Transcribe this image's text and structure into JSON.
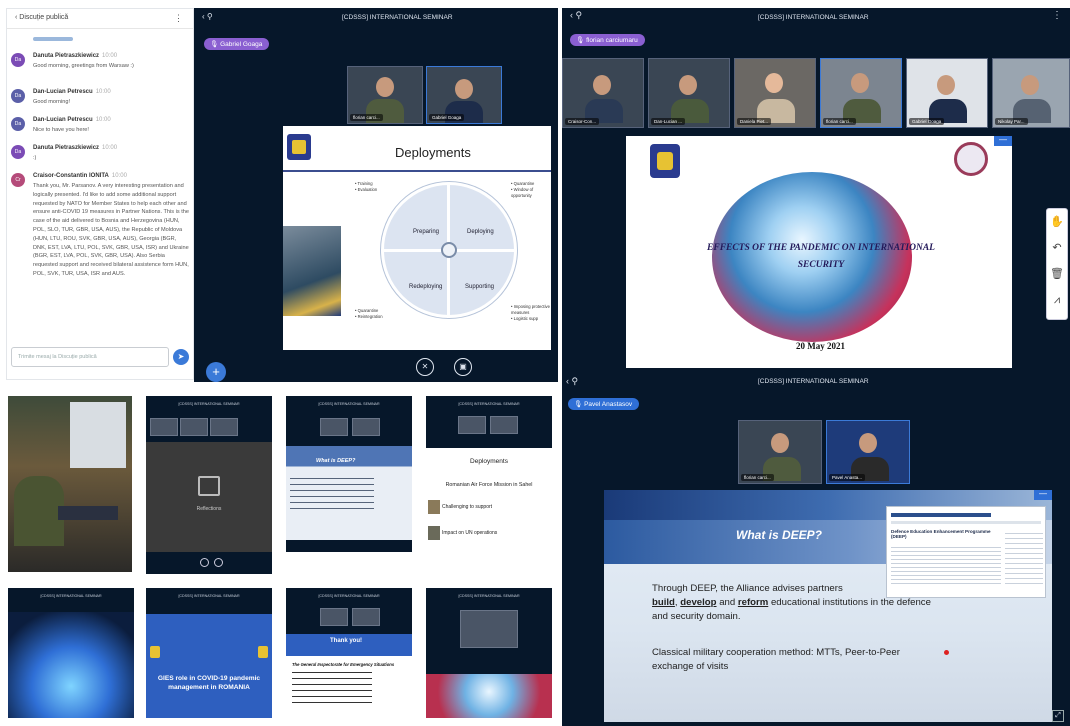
{
  "chat": {
    "title": "Discuție publică",
    "messages": [
      {
        "name": "Danuta Pietraszkiewicz",
        "time": "10:00",
        "text": "Good morning, greetings from Warsaw :)",
        "initials": "Da",
        "color": "#7b4bb5"
      },
      {
        "name": "Dan-Lucian Petrescu",
        "time": "10:00",
        "text": "Good morning!",
        "initials": "Da",
        "color": "#5b5fa8"
      },
      {
        "name": "Dan-Lucian Petrescu",
        "time": "10:00",
        "text": "Nice to have you here!",
        "initials": "Da",
        "color": "#5b5fa8"
      },
      {
        "name": "Danuta Pietraszkiewicz",
        "time": "10:00",
        "text": ":)",
        "initials": "Da",
        "color": "#7b4bb5"
      },
      {
        "name": "Craisor-Constantin IONITA",
        "time": "10:00",
        "text": "Thank you, Mr. Parsanov. A very interesting presentation and logically presented. I'd like to add some additional support requested by NATO for Member States to help each other and ensure anti-COVID 19 measures in Partner Nations. This is the case of the aid delivered to Bosnia and Herzegovina (HUN, POL, SLO, TUR, GBR, USA, AUS), the Republic of Moldova (HUN, LTU, ROU, SVK, GBR, USA, AUS), Georgia (BGR, DNK, EST, LVA, LTU, POL, SVK, GBR, USA, ISR) and Ukraine (BGR, EST, LVA, POL, SVK, GBR, USA). Also Serbia requested support and received bilateral assistence form HUN, POL, SVK, TUR, USA, ISR and AUS.",
        "initials": "Cr",
        "color": "#b54b7a"
      }
    ],
    "input_placeholder": "Trimite mesaj la Discuție publică"
  },
  "meeting1": {
    "title": "[CDSSS] INTERNATIONAL SEMINAR",
    "presenter": "Gabriel Goaga",
    "participants": [
      "florian carci...",
      "Gabriel Goaga"
    ],
    "slide": {
      "title": "Deployments",
      "quadrants": [
        "Preparing",
        "Deploying",
        "Redeploying",
        "Supporting"
      ],
      "notes_tl": "• Training\n• Evaluation",
      "notes_tr": "• Quarantine\n• Window of opportunity",
      "notes_bl": "• Quarantine\n• Reintegration",
      "notes_br": "• Imposing protective measures\n• Logistic supp"
    }
  },
  "meeting2": {
    "title": "[CDSSS] INTERNATIONAL SEMINAR",
    "presenter": "florian carciumaru",
    "participants": [
      "Craisor-Con...",
      "Dan-Lucian ...",
      "Daniela Piet...",
      "florian carci...",
      "Gabriel Goaga",
      "Nikolay Par..."
    ],
    "slide": {
      "title": "EFFECTS OF THE PANDEMIC ON INTERNATIONAL SECURITY",
      "date": "20 May 2021"
    }
  },
  "meeting3": {
    "title": "[CDSSS] INTERNATIONAL SEMINAR",
    "presenter": "Pavel Anastasov",
    "participants": [
      "florian carci...",
      "Pavel Anasta..."
    ],
    "slide": {
      "title": "What is DEEP?",
      "para1_prefix": "Through DEEP, the Alliance advises partners",
      "para1_build": "build",
      "para1_develop": "develop",
      "para1_reform": "reform",
      "para1_rest": "educational institutions in the defence and security domain.",
      "para2": "Classical military cooperation method: MTTs, Peer-to-Peer exchange of visits",
      "web_title": "Defence Education Enhancement Programme (DEEP)"
    }
  },
  "thumbnails": {
    "reflections": "Reflections",
    "deep_title": "What is DEEP?",
    "deployments_title": "Deployments",
    "sahel": "Romanian Air Force Mission in Sahel",
    "challenging": "Challenging to support",
    "impact": "Impact on UN operations",
    "gies_title": "GIES role in COVID-19 pandemic management in ROMANIA",
    "thank_you": "Thank you!",
    "gies_contact": "The General Inspectorate for Emergency Situations",
    "seminar_label": "[CDSSS] INTERNATIONAL SEMINAR"
  },
  "colors": {
    "dark": "#06172a",
    "accent_purple": "#8a5fd1",
    "accent_blue": "#2f6fd6"
  }
}
